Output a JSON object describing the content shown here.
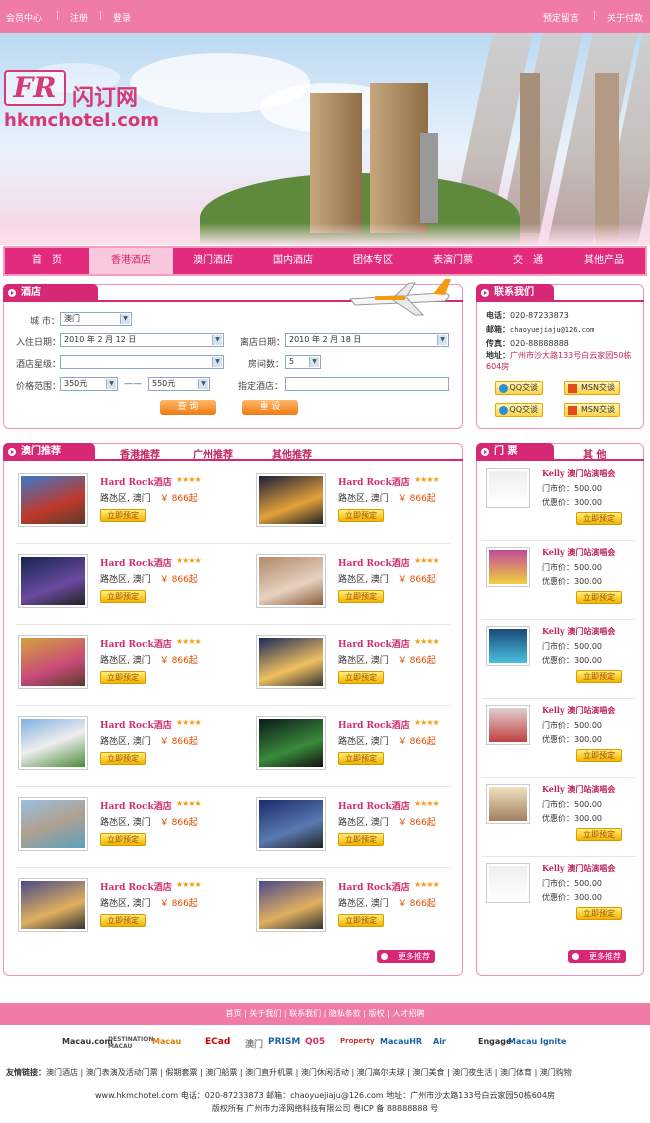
{
  "top": {
    "links_left": [
      "会员中心",
      "注册",
      "登录"
    ],
    "links_right": [
      "预定留言",
      "关于付款"
    ]
  },
  "logo": {
    "fr": "FR",
    "cn": "闪订网",
    "en": "hkmchotel.com"
  },
  "nav": [
    "首　页",
    "香港酒店",
    "澳门酒店",
    "国内酒店",
    "团体专区",
    "表演门票",
    "交　通",
    "其他产品"
  ],
  "search": {
    "title": "酒店",
    "city_label": "城  市：",
    "city_value": "澳门",
    "checkin_label": "入住日期：",
    "checkin_value": "2010 年 2 月 12 日",
    "checkout_label": "离店日期：",
    "checkout_value": "2010 年 2 月 18 日",
    "star_label": "酒店星级：",
    "star_value": "",
    "rooms_label": "房间数：",
    "rooms_value": "5",
    "price_label": "价格范围：",
    "price_min": "350元",
    "price_sep": "——",
    "price_max": "550元",
    "hotel_label": "指定酒店：",
    "hotel_value": "",
    "btn_search": "查  询",
    "btn_reset": "重  设"
  },
  "contact": {
    "title": "联系我们",
    "phone_label": "电话：",
    "phone": "020-87233873",
    "email_label": "邮箱：",
    "email": "chaoyuejiaju@126.com",
    "fax_label": "传真：",
    "fax": "020-88888888",
    "addr_label": "地址：",
    "addr": "广州市沙大路133号白云家园50栋604房",
    "qq_label": "QQ交谈",
    "msn_label": "MSN交谈"
  },
  "recommend": {
    "tabs": [
      "澳门推荐",
      "香港推荐",
      "广州推荐",
      "其他推荐"
    ],
    "hotel_name": "Hard Rock酒店",
    "stars": "★★★★",
    "location": "路氹区, 澳门",
    "price": "￥ 866起",
    "book": "立即预定",
    "more": "更多推荐"
  },
  "tickets": {
    "tabs": [
      "门  票",
      "其  他"
    ],
    "title": "Kelly 澳门站演唱会",
    "market_label": "门市价：",
    "market": "500.00",
    "offer_label": "优惠价：",
    "offer": "300.00",
    "book": "立即预定",
    "more": "更多推荐"
  },
  "footer": {
    "nav": "首页  |  关于我们  |  联系我们  |  隐私条款  |  版权  |  人才招聘",
    "partners": [
      "Macau.com",
      "DESTINATION MACAU",
      "Macau",
      "ECad",
      "澳门",
      "PRISM",
      "Q05",
      "Property",
      "MacauHR",
      "Air",
      "Engage",
      "Macau Ignite"
    ],
    "friend_label": "友情链接：",
    "friend_links": "澳门酒店 | 澳门表演及活动门票 | 假期套票 | 澳门船票 | 澳门直升机票 | 澳门休闲活动 | 澳门高尔夫球 | 澳门美食 | 澳门夜生活 | 澳门体育 | 澳门购物",
    "line1": "www.hkmchotel.com    电话：020-87233873    邮箱：chaoyuejiaju@126.com    地址：广州市沙太路133号白云家园50栋604房",
    "line2": "版权所有 广州市力泽网络科技有限公司 粤ICP 备 88888888 号"
  }
}
